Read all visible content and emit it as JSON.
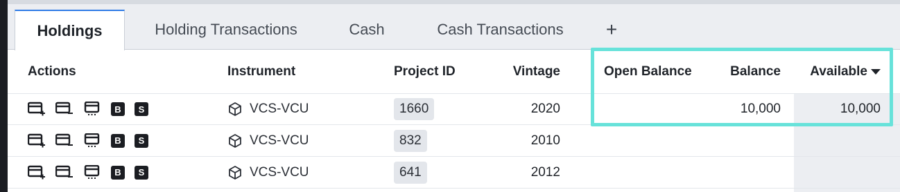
{
  "tabs": [
    {
      "label": "Holdings",
      "active": true
    },
    {
      "label": "Holding Transactions",
      "active": false
    },
    {
      "label": "Cash",
      "active": false
    },
    {
      "label": "Cash Transactions",
      "active": false
    }
  ],
  "add_tab_label": "+",
  "columns": {
    "actions": "Actions",
    "instrument": "Instrument",
    "project_id": "Project ID",
    "vintage": "Vintage",
    "open_balance": "Open Balance",
    "balance": "Balance",
    "available": "Available"
  },
  "sort": {
    "column": "Available",
    "direction": "descending"
  },
  "action_icons": [
    "card-add-icon",
    "card-remove-icon",
    "card-details-icon",
    "buy-icon",
    "sell-icon"
  ],
  "badge_labels": {
    "buy": "B",
    "sell": "S"
  },
  "rows": [
    {
      "instrument": "VCS-VCU",
      "project_id": "1660",
      "vintage": "2020",
      "open_balance": "",
      "balance": "10,000",
      "available": "10,000"
    },
    {
      "instrument": "VCS-VCU",
      "project_id": "832",
      "vintage": "2010",
      "open_balance": "",
      "balance": "",
      "available": ""
    },
    {
      "instrument": "VCS-VCU",
      "project_id": "641",
      "vintage": "2012",
      "open_balance": "",
      "balance": "",
      "available": ""
    }
  ],
  "colors": {
    "accent": "#2f7be6",
    "highlight": "#67e2da",
    "tabbar_bg": "#eceef2",
    "chip_bg": "#e3e6eb"
  }
}
